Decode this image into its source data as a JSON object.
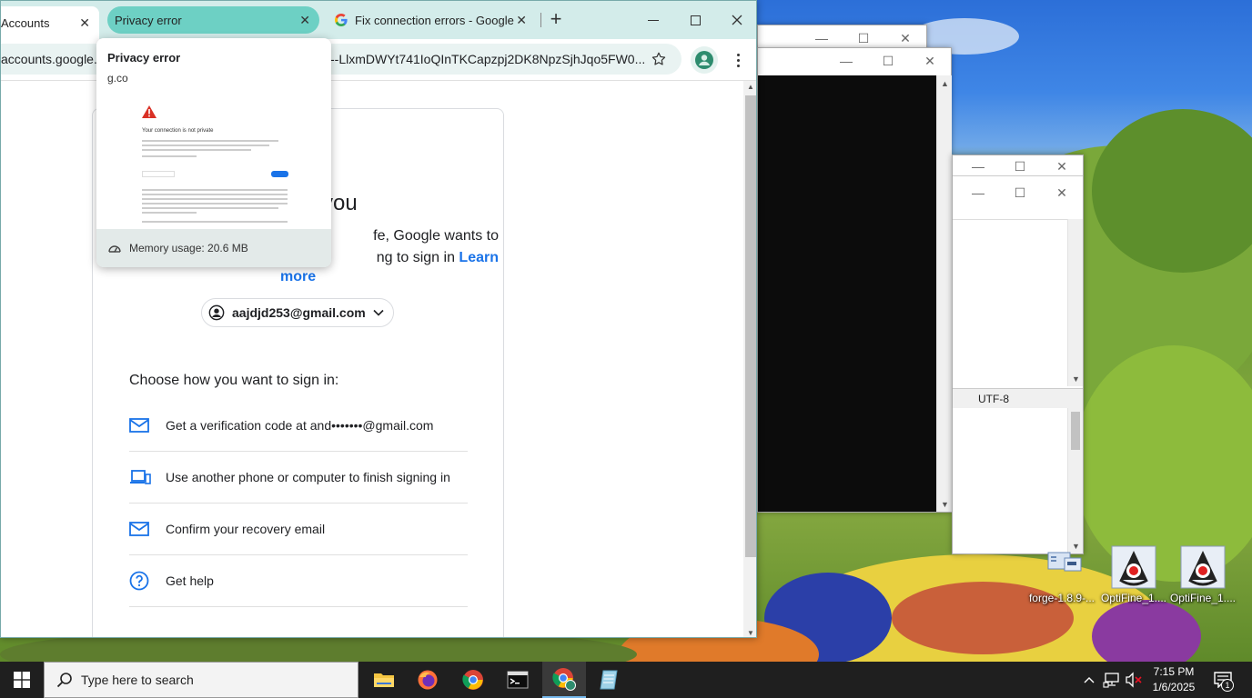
{
  "browser": {
    "tabs": [
      {
        "label": "Accounts",
        "close": "✕"
      },
      {
        "label": "Privacy error",
        "close": "✕"
      },
      {
        "label": "Fix connection errors - Google",
        "close": "✕"
      }
    ],
    "new_tab": "+",
    "address_left": "accounts.google.c",
    "address_right": "--LlxmDWYt741IoQInTKCapzpj2DK8NpzSjhJqo5FW0...",
    "hover_card": {
      "title": "Privacy error",
      "domain": "g.co",
      "preview_heading": "Your connection is not private",
      "memory": "Memory usage: 20.6 MB"
    }
  },
  "page": {
    "heading_fragment": "you",
    "desc_line1": "fe, Google wants to",
    "desc_line2": "ng to sign in",
    "learn": "Learn",
    "more": "more",
    "account_email": "aajdjd253@gmail.com",
    "choose_heading": "Choose how you want to sign in:",
    "options": [
      {
        "icon": "mail-icon",
        "label": "Get a verification code at and•••••••@gmail.com"
      },
      {
        "icon": "devices-icon",
        "label": "Use another phone or computer to finish signing in"
      },
      {
        "icon": "mail-icon",
        "label": "Confirm your recovery email"
      },
      {
        "icon": "help-icon",
        "label": "Get help"
      }
    ]
  },
  "background_windows": {
    "encoding": "UTF-8"
  },
  "desktop_icons": [
    {
      "label": "forge-1.8.9-..."
    },
    {
      "label": "OptiFine_1...."
    },
    {
      "label": "OptiFine_1...."
    }
  ],
  "taskbar": {
    "search_placeholder": "Type here to search",
    "time": "7:15 PM",
    "date": "1/6/2025",
    "notification_count": "1"
  },
  "colors": {
    "tabstrip": "#d3ecea",
    "active_tab": "#6dd0c4",
    "link": "#1a73e8",
    "icon_blue": "#1a73e8"
  }
}
